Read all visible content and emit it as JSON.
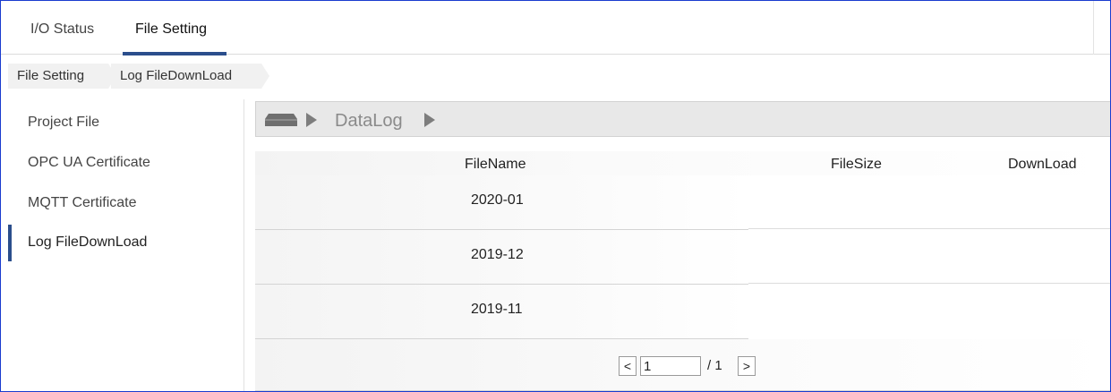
{
  "tabs": [
    {
      "label": "I/O Status",
      "active": false
    },
    {
      "label": "File Setting",
      "active": true
    }
  ],
  "breadcrumb": [
    "File Setting",
    "Log FileDownLoad"
  ],
  "sidebar": {
    "items": [
      {
        "label": "Project File",
        "active": false
      },
      {
        "label": "OPC UA Certificate",
        "active": false
      },
      {
        "label": "MQTT Certificate",
        "active": false
      },
      {
        "label": "Log FileDownLoad",
        "active": true
      }
    ]
  },
  "pathbar": {
    "icon": "drive-icon",
    "folder": "DataLog"
  },
  "table": {
    "columns": [
      "FileName",
      "FileSize",
      "DownLoad"
    ],
    "rows": [
      {
        "name": "2020-01"
      },
      {
        "name": "2019-12"
      },
      {
        "name": "2019-11"
      }
    ]
  },
  "pager": {
    "prev_label": "<",
    "current_page": "1",
    "total_label": "/ 1",
    "next_label": ">"
  },
  "colors": {
    "accent": "#2b4e8c",
    "frame_border": "#1a3ccf"
  }
}
